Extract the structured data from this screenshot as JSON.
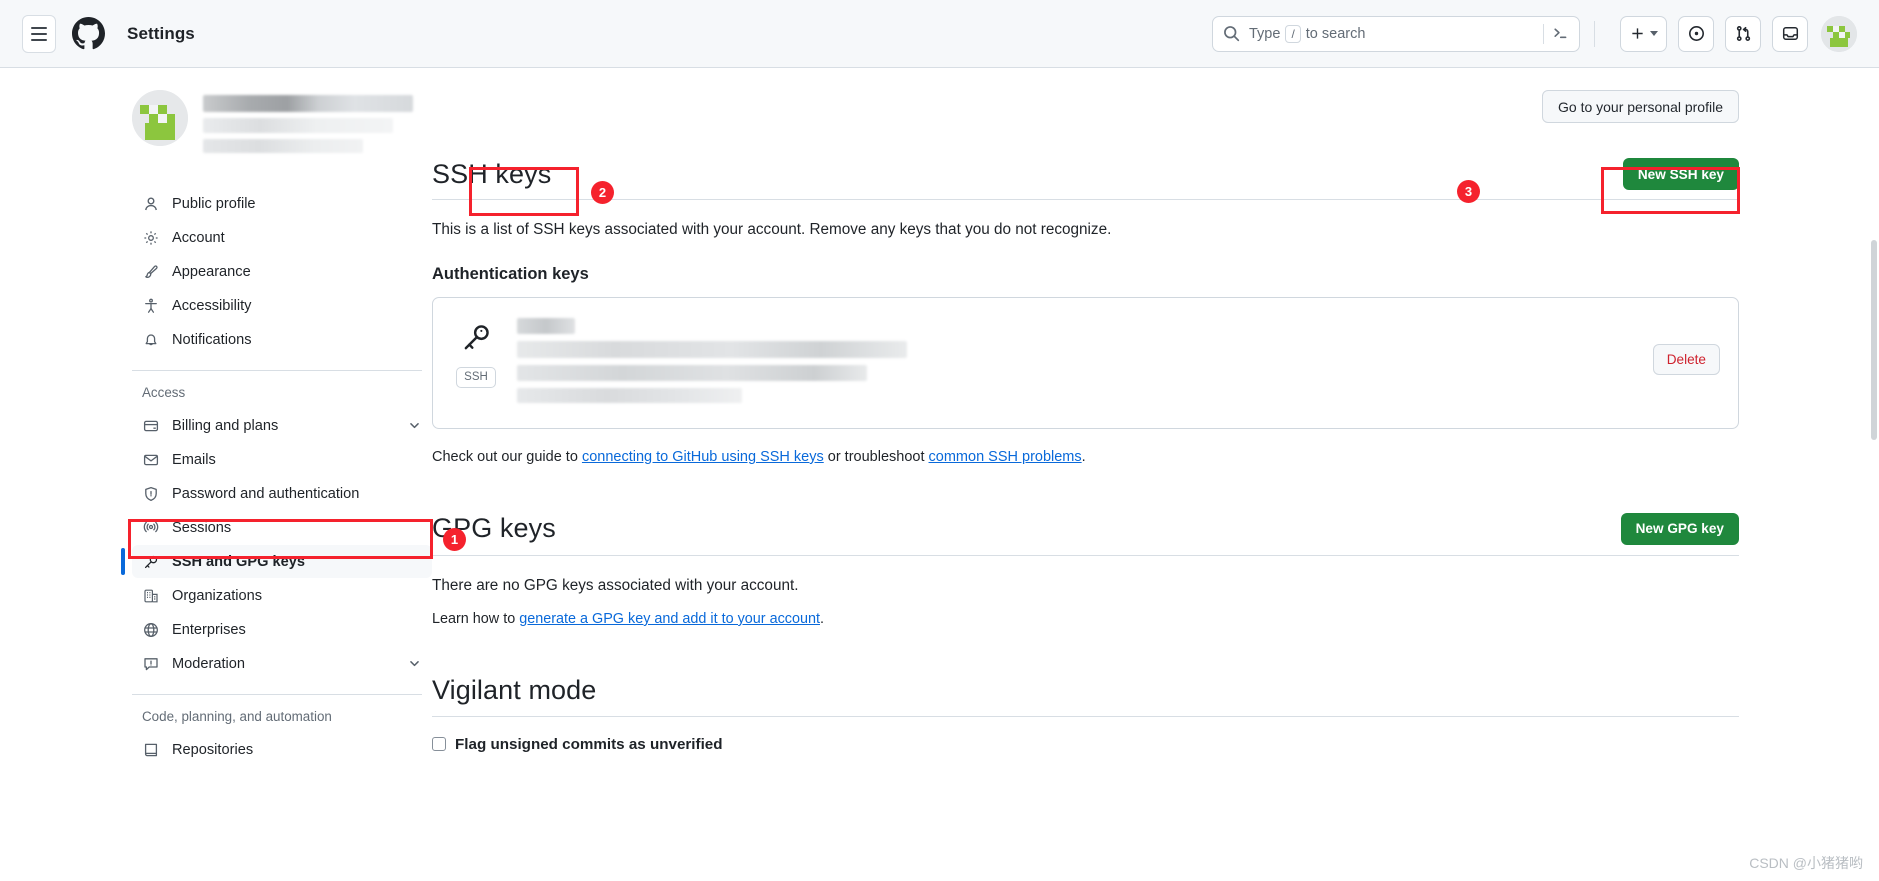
{
  "header": {
    "menu_icon": "hamburger-icon",
    "logo_icon": "github-logo-icon",
    "title": "Settings",
    "search": {
      "icon": "search-icon",
      "placeholder_prefix": "Type",
      "placeholder_key": "/",
      "placeholder_suffix": "to search",
      "terminal_icon": "command-palette-icon"
    },
    "actions": [
      {
        "name": "create-new-button",
        "icon": "plus-icon",
        "has_caret": true
      },
      {
        "name": "issues-button",
        "icon": "issue-opened-icon"
      },
      {
        "name": "pull-requests-button",
        "icon": "git-pull-request-icon"
      },
      {
        "name": "notifications-button",
        "icon": "inbox-icon"
      }
    ],
    "avatar": "user-avatar"
  },
  "sidebar": {
    "profile": {
      "avatar": "user-avatar-large",
      "name_redacted": true
    },
    "sections": [
      {
        "title": "",
        "items": [
          {
            "label": "Public profile",
            "icon": "person-icon",
            "selected": false,
            "chevron": false
          },
          {
            "label": "Account",
            "icon": "gear-icon",
            "selected": false,
            "chevron": false
          },
          {
            "label": "Appearance",
            "icon": "paintbrush-icon",
            "selected": false,
            "chevron": false
          },
          {
            "label": "Accessibility",
            "icon": "accessibility-icon",
            "selected": false,
            "chevron": false
          },
          {
            "label": "Notifications",
            "icon": "bell-icon",
            "selected": false,
            "chevron": false
          }
        ]
      },
      {
        "title": "Access",
        "items": [
          {
            "label": "Billing and plans",
            "icon": "credit-card-icon",
            "selected": false,
            "chevron": true
          },
          {
            "label": "Emails",
            "icon": "mail-icon",
            "selected": false,
            "chevron": false
          },
          {
            "label": "Password and authentication",
            "icon": "shield-lock-icon",
            "selected": false,
            "chevron": false
          },
          {
            "label": "Sessions",
            "icon": "broadcast-icon",
            "selected": false,
            "chevron": false
          },
          {
            "label": "SSH and GPG keys",
            "icon": "key-icon",
            "selected": true,
            "chevron": false
          },
          {
            "label": "Organizations",
            "icon": "organization-icon",
            "selected": false,
            "chevron": false
          },
          {
            "label": "Enterprises",
            "icon": "globe-icon",
            "selected": false,
            "chevron": false
          },
          {
            "label": "Moderation",
            "icon": "report-icon",
            "selected": false,
            "chevron": true
          }
        ]
      },
      {
        "title": "Code, planning, and automation",
        "items": [
          {
            "label": "Repositories",
            "icon": "repo-icon",
            "selected": false,
            "chevron": false
          }
        ]
      }
    ]
  },
  "main": {
    "personal_profile_button": "Go to your personal profile",
    "ssh": {
      "title": "SSH keys",
      "new_button": "New SSH key",
      "description": "This is a list of SSH keys associated with your account. Remove any keys that you do not recognize.",
      "subheading": "Authentication keys",
      "key_card": {
        "icon": "key-icon",
        "type_chip": "SSH",
        "title_redacted": true,
        "fingerprint_redacted": true,
        "delete_button": "Delete"
      },
      "guide_prefix": "Check out our guide to ",
      "guide_link1": "connecting to GitHub using SSH keys",
      "guide_middle": " or troubleshoot ",
      "guide_link2": "common SSH problems",
      "guide_suffix": "."
    },
    "gpg": {
      "title": "GPG keys",
      "new_button": "New GPG key",
      "empty_text": "There are no GPG keys associated with your account.",
      "learn_prefix": "Learn how to ",
      "learn_link": "generate a GPG key and add it to your account",
      "learn_suffix": "."
    },
    "vigilant": {
      "title": "Vigilant mode",
      "checkbox_label": "Flag unsigned commits as unverified"
    }
  },
  "annotations": [
    {
      "number": "1",
      "target": "sidebar-item-ssh-and-gpg-keys"
    },
    {
      "number": "2",
      "target": "ssh-keys-heading"
    },
    {
      "number": "3",
      "target": "new-ssh-key-button"
    }
  ],
  "watermark": "CSDN @小猪猪哟",
  "colors": {
    "accent_green": "#1f883d",
    "link_blue": "#0969da",
    "danger_red": "#cf222e",
    "annotation_red": "#f5222d",
    "selected_bar": "#0969da"
  }
}
